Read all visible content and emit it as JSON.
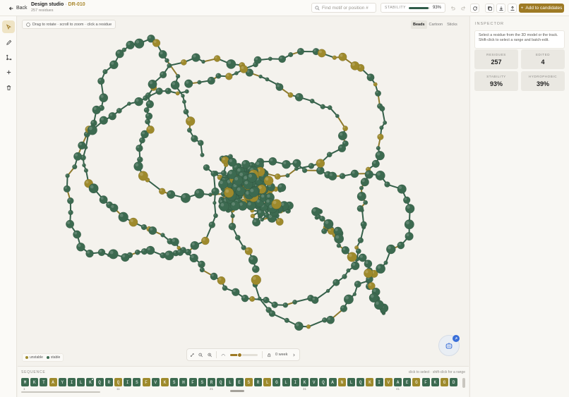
{
  "header": {
    "back_label": "Back",
    "title": "Design studio",
    "title_separator": "·",
    "design_code": "DR-010",
    "subtitle": "257 residues",
    "search_placeholder": "Find motif or position #",
    "stability_label": "STABILITY",
    "stability_value": "93%",
    "stability_fraction": 0.93,
    "add_button_label": "Add to candidates"
  },
  "viewport": {
    "hint": "Drag to rotate · scroll to zoom · click a residue",
    "view_modes": [
      {
        "label": "Beads",
        "active": true
      },
      {
        "label": "Cartoon",
        "active": false
      },
      {
        "label": "Sticks",
        "active": false
      }
    ],
    "legend": {
      "unstable": "unstable",
      "stable": "stable"
    },
    "zoom_fraction": 0.35,
    "frame_label": "0 week",
    "colors": {
      "stable": "#3c6a50",
      "unstable": "#9e8a2c",
      "accent": "#9e7a24"
    }
  },
  "inspector": {
    "title": "INSPECTOR",
    "help": "Select a residue from the 3D model or the track. Shift-click to select a range and batch-edit.",
    "stats": [
      {
        "label": "RESIDUES",
        "value": "257"
      },
      {
        "label": "EDITED",
        "value": "4"
      },
      {
        "label": "STABILITY",
        "value": "93%"
      },
      {
        "label": "HYDROPHOBIC",
        "value": "39%"
      }
    ]
  },
  "sequence": {
    "title": "SEQUENCE",
    "hint": "click to select · shift-click for a range",
    "residues": [
      "M",
      "K",
      "T",
      "A",
      "Y",
      "I",
      "L",
      "K",
      "Q",
      "R",
      "Q",
      "I",
      "S",
      "F",
      "V",
      "K",
      "S",
      "H",
      "F",
      "S",
      "R",
      "Q",
      "L",
      "E",
      "S",
      "R",
      "L",
      "G",
      "L",
      "I",
      "K",
      "V",
      "Q",
      "A",
      "N",
      "L",
      "Q",
      "K",
      "I",
      "V",
      "A",
      "E",
      "G",
      "F",
      "K",
      "G",
      "D"
    ],
    "unstable_indices": [
      3,
      10,
      13,
      15,
      24,
      26,
      34,
      37,
      39,
      42,
      45,
      47
    ],
    "edited_indices": [
      7
    ],
    "tick_labels": [
      {
        "index": 0,
        "label": "1"
      },
      {
        "index": 10,
        "label": "11"
      },
      {
        "index": 20,
        "label": "21"
      },
      {
        "index": 30,
        "label": "31"
      },
      {
        "index": 40,
        "label": "41"
      }
    ]
  }
}
